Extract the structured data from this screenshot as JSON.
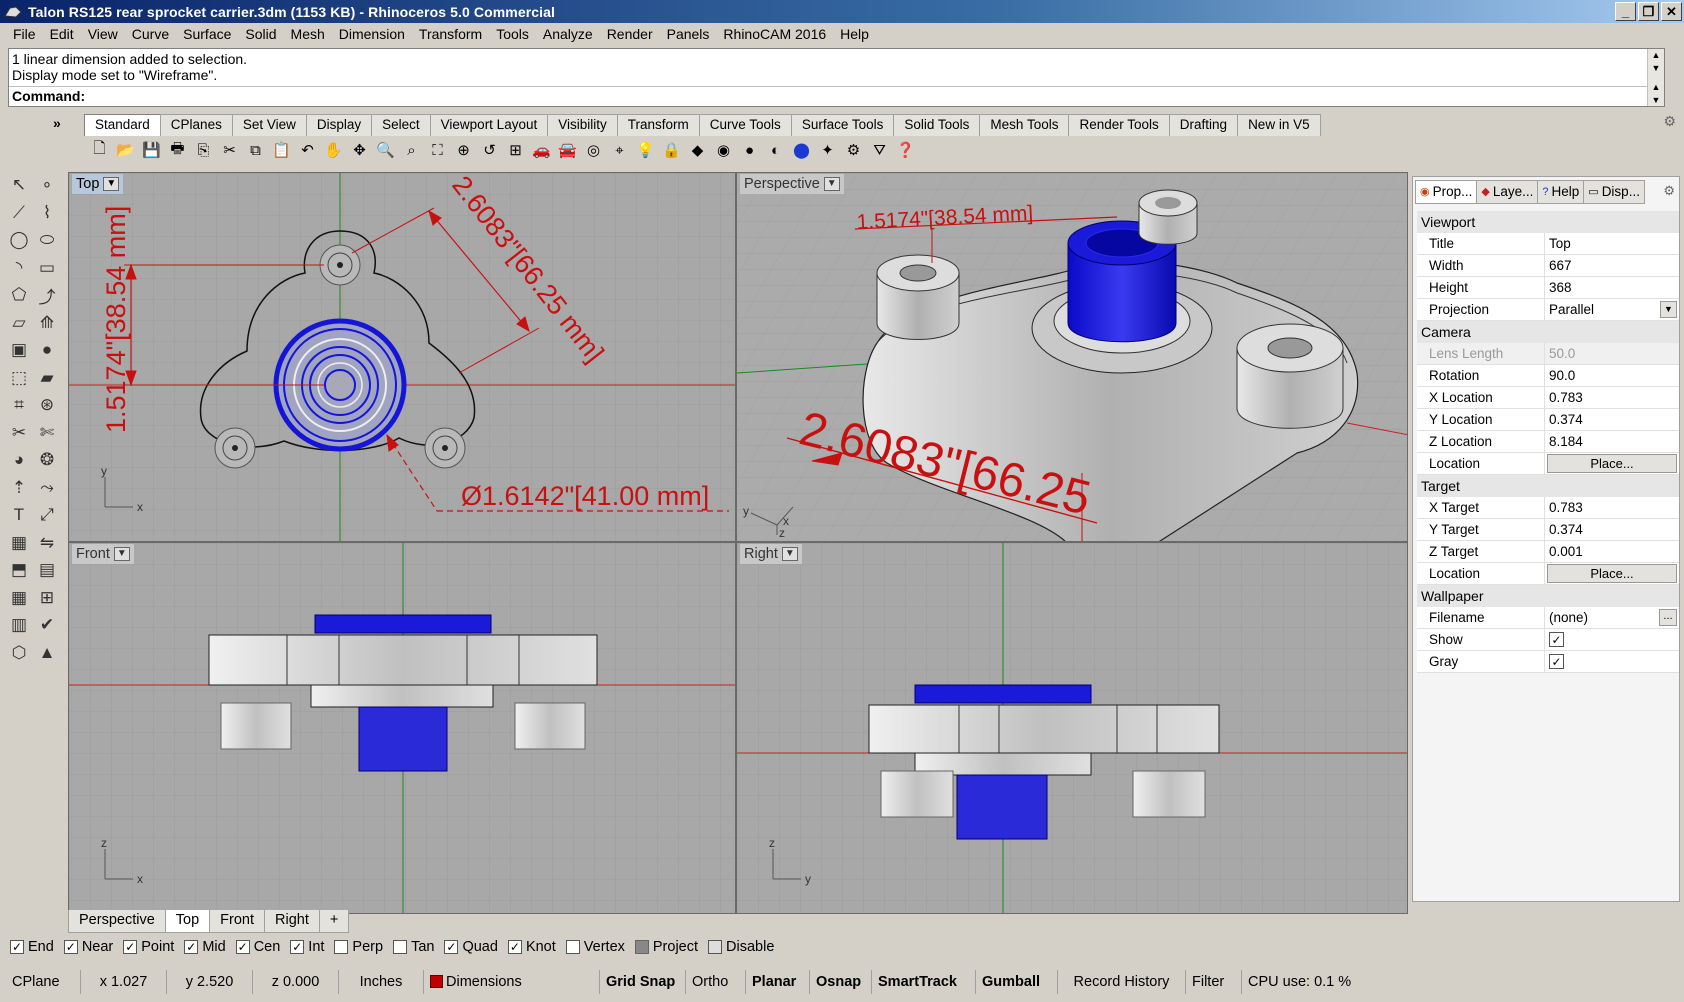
{
  "window": {
    "title": "Talon RS125 rear sprocket carrier.3dm (1153 KB) - Rhinoceros 5.0 Commercial",
    "min_label": "_",
    "restore_label": "❐",
    "close_label": "✕"
  },
  "menu": [
    "File",
    "Edit",
    "View",
    "Curve",
    "Surface",
    "Solid",
    "Mesh",
    "Dimension",
    "Transform",
    "Tools",
    "Analyze",
    "Render",
    "Panels",
    "RhinoCAM 2016",
    "Help"
  ],
  "command": {
    "history": [
      "1 linear dimension added to selection.",
      "Display mode set to \"Wireframe\"."
    ],
    "prompt": "Command:"
  },
  "toolbar_tabs": [
    "Standard",
    "CPlanes",
    "Set View",
    "Display",
    "Select",
    "Viewport Layout",
    "Visibility",
    "Transform",
    "Curve Tools",
    "Surface Tools",
    "Solid Tools",
    "Mesh Tools",
    "Render Tools",
    "Drafting",
    "New in V5"
  ],
  "toolbar_icons": [
    "new-file-icon",
    "open-file-icon",
    "save-icon",
    "print-icon",
    "import-icon",
    "cut-icon",
    "copy-icon",
    "paste-icon",
    "undo-icon",
    "pan-icon",
    "rotate-view-icon",
    "zoom-window-icon",
    "zoom-dynamic-icon",
    "zoom-extents-icon",
    "zoom-selected-icon",
    "undo-view-icon",
    "four-viewports-icon",
    "car-icon",
    "perspective-car-icon",
    "select-point-icon",
    "cursor-properties-icon",
    "light-bulb-icon",
    "lock-icon",
    "render-icon",
    "color-wheel-icon",
    "shaded-sphere-icon",
    "rendered-sphere-icon",
    "blue-sphere-icon",
    "spotlight-icon",
    "options-icon",
    "filter-icon",
    "help-icon"
  ],
  "viewports": {
    "top": {
      "label": "Top",
      "dim_vertical": "1.5174\"[38.54 mm]",
      "dim_aligned": "2.6083\"[66.25 mm]",
      "dim_diameter": "Ø1.6142\"[41.00 mm]",
      "axis_x": "x",
      "axis_y": "y"
    },
    "perspective": {
      "label": "Perspective",
      "dim_top": "1.5174\"[38.54 mm]",
      "dim_big": "2.6083\"[66.25",
      "axis_x": "x",
      "axis_y": "y",
      "axis_z": "z"
    },
    "front": {
      "label": "Front",
      "axis_x": "x",
      "axis_z": "z"
    },
    "right": {
      "label": "Right",
      "axis_y": "y",
      "axis_z": "z"
    }
  },
  "viewport_tabs": [
    "Perspective",
    "Top",
    "Front",
    "Right"
  ],
  "viewport_tab_add": "+",
  "active_viewport_tab": "Top",
  "osnaps": [
    {
      "label": "End",
      "checked": true
    },
    {
      "label": "Near",
      "checked": true
    },
    {
      "label": "Point",
      "checked": true
    },
    {
      "label": "Mid",
      "checked": true
    },
    {
      "label": "Cen",
      "checked": true
    },
    {
      "label": "Int",
      "checked": true
    },
    {
      "label": "Perp",
      "checked": false
    },
    {
      "label": "Tan",
      "checked": false
    },
    {
      "label": "Quad",
      "checked": true
    },
    {
      "label": "Knot",
      "checked": true
    },
    {
      "label": "Vertex",
      "checked": false
    },
    {
      "label": "Project",
      "checked": false
    },
    {
      "label": "Disable",
      "checked": false
    }
  ],
  "status": {
    "cplane": "CPlane",
    "x": "x 1.027",
    "y": "y 2.520",
    "z": "z 0.000",
    "units": "Inches",
    "layer": "Dimensions",
    "layer_color": "#c00000",
    "grid_snap": "Grid Snap",
    "ortho": "Ortho",
    "planar": "Planar",
    "osnap": "Osnap",
    "smarttrack": "SmartTrack",
    "gumball": "Gumball",
    "record_history": "Record History",
    "filter": "Filter",
    "cpu": "CPU use: 0.1 %"
  },
  "panel": {
    "tabs": [
      "Prop...",
      "Laye...",
      "Help",
      "Disp..."
    ],
    "sections": [
      {
        "title": "Viewport",
        "rows": [
          {
            "label": "Title",
            "value": "Top"
          },
          {
            "label": "Width",
            "value": "667"
          },
          {
            "label": "Height",
            "value": "368"
          },
          {
            "label": "Projection",
            "value": "Parallel",
            "dropdown": true
          }
        ]
      },
      {
        "title": "Camera",
        "rows": [
          {
            "label": "Lens Length",
            "value": "50.0",
            "disabled": true
          },
          {
            "label": "Rotation",
            "value": "90.0"
          },
          {
            "label": "X Location",
            "value": "0.783"
          },
          {
            "label": "Y Location",
            "value": "0.374"
          },
          {
            "label": "Z Location",
            "value": "8.184"
          },
          {
            "label": "Location",
            "button": "Place..."
          }
        ]
      },
      {
        "title": "Target",
        "rows": [
          {
            "label": "X Target",
            "value": "0.783"
          },
          {
            "label": "Y Target",
            "value": "0.374"
          },
          {
            "label": "Z Target",
            "value": "0.001"
          },
          {
            "label": "Location",
            "button": "Place..."
          }
        ]
      },
      {
        "title": "Wallpaper",
        "rows": [
          {
            "label": "Filename",
            "value": "(none)",
            "dots": "..."
          },
          {
            "label": "Show",
            "checkbox": true
          },
          {
            "label": "Gray",
            "checkbox": true
          }
        ]
      }
    ]
  },
  "colors": {
    "dimension": "#c81010",
    "selection": "#1515d8",
    "viewport_bg": "#a8a8a8",
    "grid": "#989898"
  }
}
